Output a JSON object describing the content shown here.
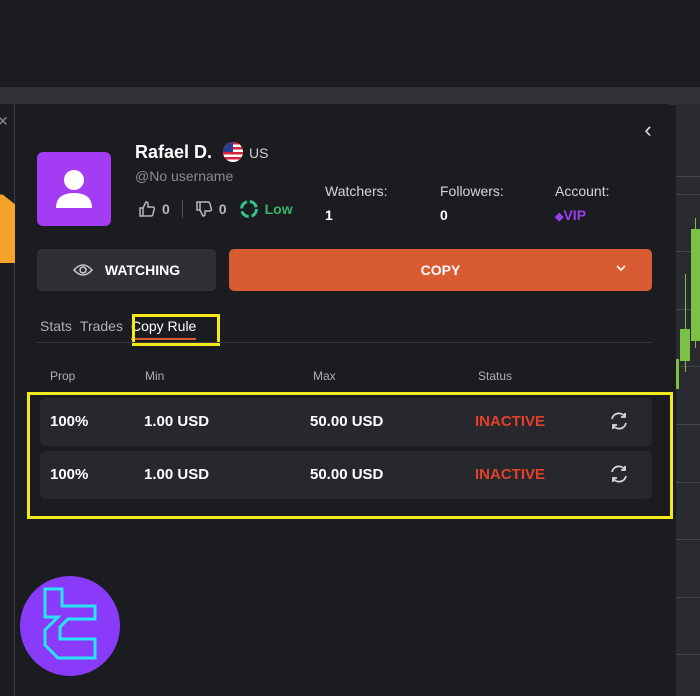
{
  "trader": {
    "name": "Rafael D.",
    "country": "US",
    "username": "@No username",
    "likes": "0",
    "dislikes": "0",
    "risk_level": "Low"
  },
  "stats": [
    {
      "label": "Watchers:",
      "value": "1"
    },
    {
      "label": "Followers:",
      "value": "0"
    },
    {
      "label": "Account:",
      "value": "VIP"
    }
  ],
  "actions": {
    "watching_label": "WATCHING",
    "copy_label": "COPY"
  },
  "tabs": [
    {
      "label": "Stats",
      "active": false
    },
    {
      "label": "Trades",
      "active": false
    },
    {
      "label": "Copy Rule",
      "active": true
    }
  ],
  "table": {
    "headers": [
      "Prop",
      "Min",
      "Max",
      "Status"
    ],
    "rows": [
      {
        "prop": "100%",
        "min": "1.00 USD",
        "max": "50.00 USD",
        "status": "INACTIVE"
      },
      {
        "prop": "100%",
        "min": "1.00 USD",
        "max": "50.00 USD",
        "status": "INACTIVE"
      }
    ]
  },
  "colors": {
    "accent": "#d85b32",
    "status_inactive": "#e2402b",
    "vip": "#9b3ef0",
    "risk_low": "#38b56a",
    "highlight": "#f2ea1a"
  }
}
